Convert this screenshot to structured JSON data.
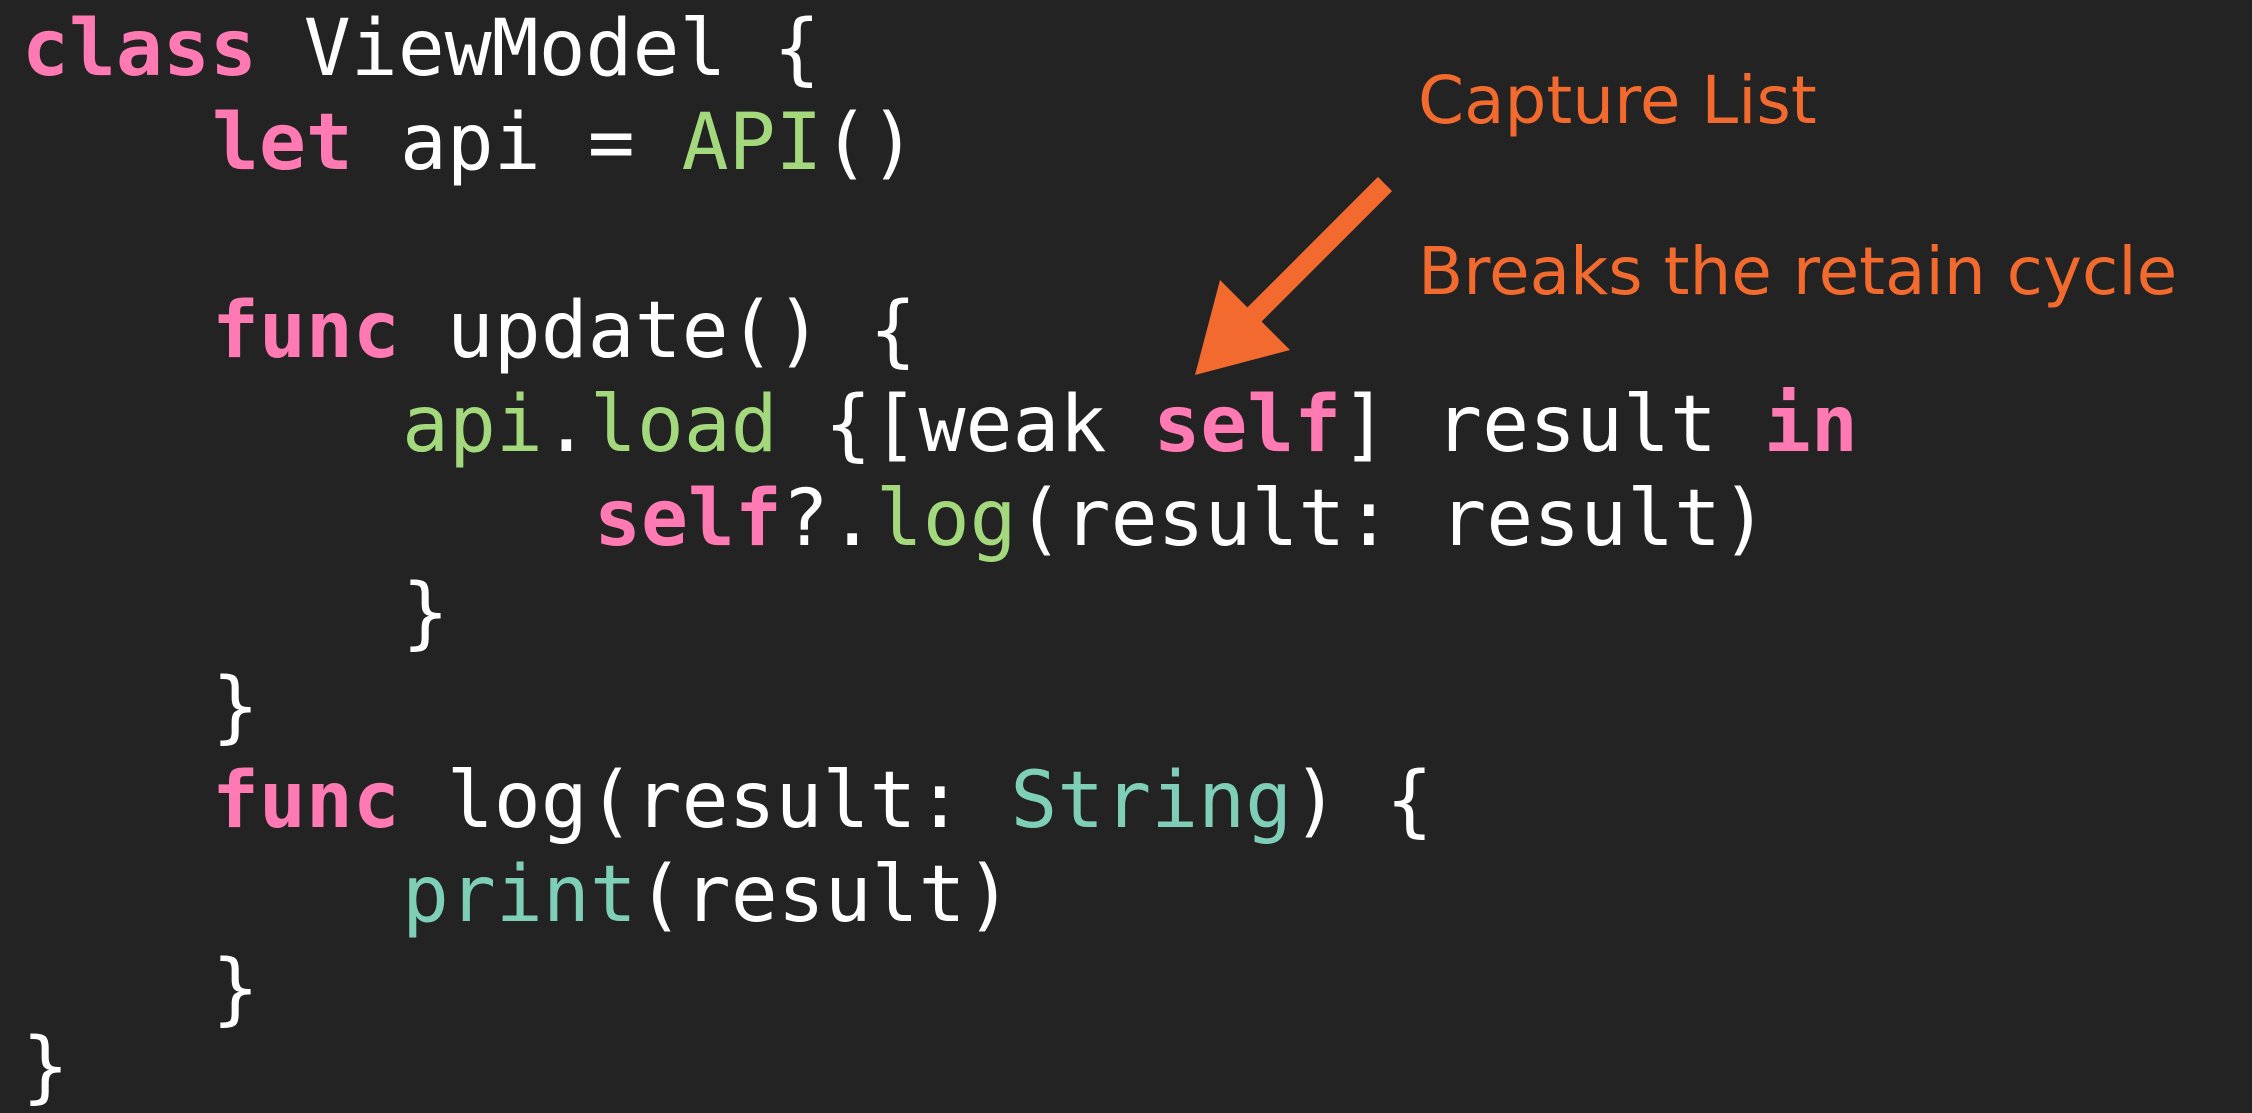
{
  "code": {
    "l1": {
      "k": "class",
      "t": " ViewModel {"
    },
    "l2": {
      "k": "let",
      "a": " api = ",
      "b": "API",
      "c": "()"
    },
    "l4": {
      "k": "func",
      "t": " update() {"
    },
    "l5": {
      "a": "api",
      "b": ".",
      "c": "load",
      "d": " {[weak ",
      "e": "self",
      "f": "] result ",
      "g": "in"
    },
    "l6": {
      "a": "self",
      "b": "?.",
      "c": "log",
      "d": "(result: result)"
    },
    "l7": "}",
    "l8": "}",
    "l9": {
      "k": "func",
      "a": " log(result: ",
      "b": "String",
      "c": ") {"
    },
    "l10": {
      "a": "print",
      "b": "(result)"
    },
    "l11": "}",
    "l12": "}"
  },
  "annotations": {
    "capture_list": "Capture List",
    "breaks_cycle": "Breaks the retain cycle"
  },
  "colors": {
    "background": "#232323",
    "keyword": "#ff7ab2",
    "identifier_green": "#a3d97c",
    "type_teal": "#7fcfb8",
    "annotation": "#f26a2e"
  }
}
